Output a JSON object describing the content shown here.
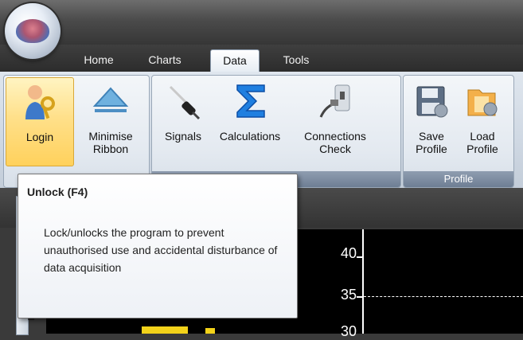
{
  "tabs": [
    "Home",
    "Charts",
    "Data",
    "Tools"
  ],
  "active_tab": "Data",
  "ribbon": {
    "groups": [
      {
        "label": ""
      },
      {
        "label": "guration"
      },
      {
        "label": "Profile"
      }
    ],
    "buttons": {
      "login": "Login",
      "minimise": "Minimise\nRibbon",
      "signals": "Signals",
      "calculations": "Calculations",
      "connections": "Connections\nCheck",
      "save_profile": "Save\nProfile",
      "load_profile": "Load\nProfile"
    }
  },
  "tooltip": {
    "title": "Unlock (F4)",
    "body": "Lock/unlocks the program to prevent unauthorised use and accidental disturbance of data acquisition"
  },
  "chart": {
    "y_ticks": [
      "40",
      "35",
      "30"
    ]
  },
  "side_tab_glyph": "Σ",
  "icons": [
    "app-orb-icon",
    "login-key-icon",
    "minimise-triangle-icon",
    "signals-probe-icon",
    "calculations-sigma-icon",
    "connections-check-icon",
    "save-profile-icon",
    "load-profile-icon"
  ],
  "colors": {
    "hot_button": "#ffd15c",
    "group_label": "#7a8aa0",
    "chart_bg": "#000000",
    "trace": "#f2d21a"
  }
}
